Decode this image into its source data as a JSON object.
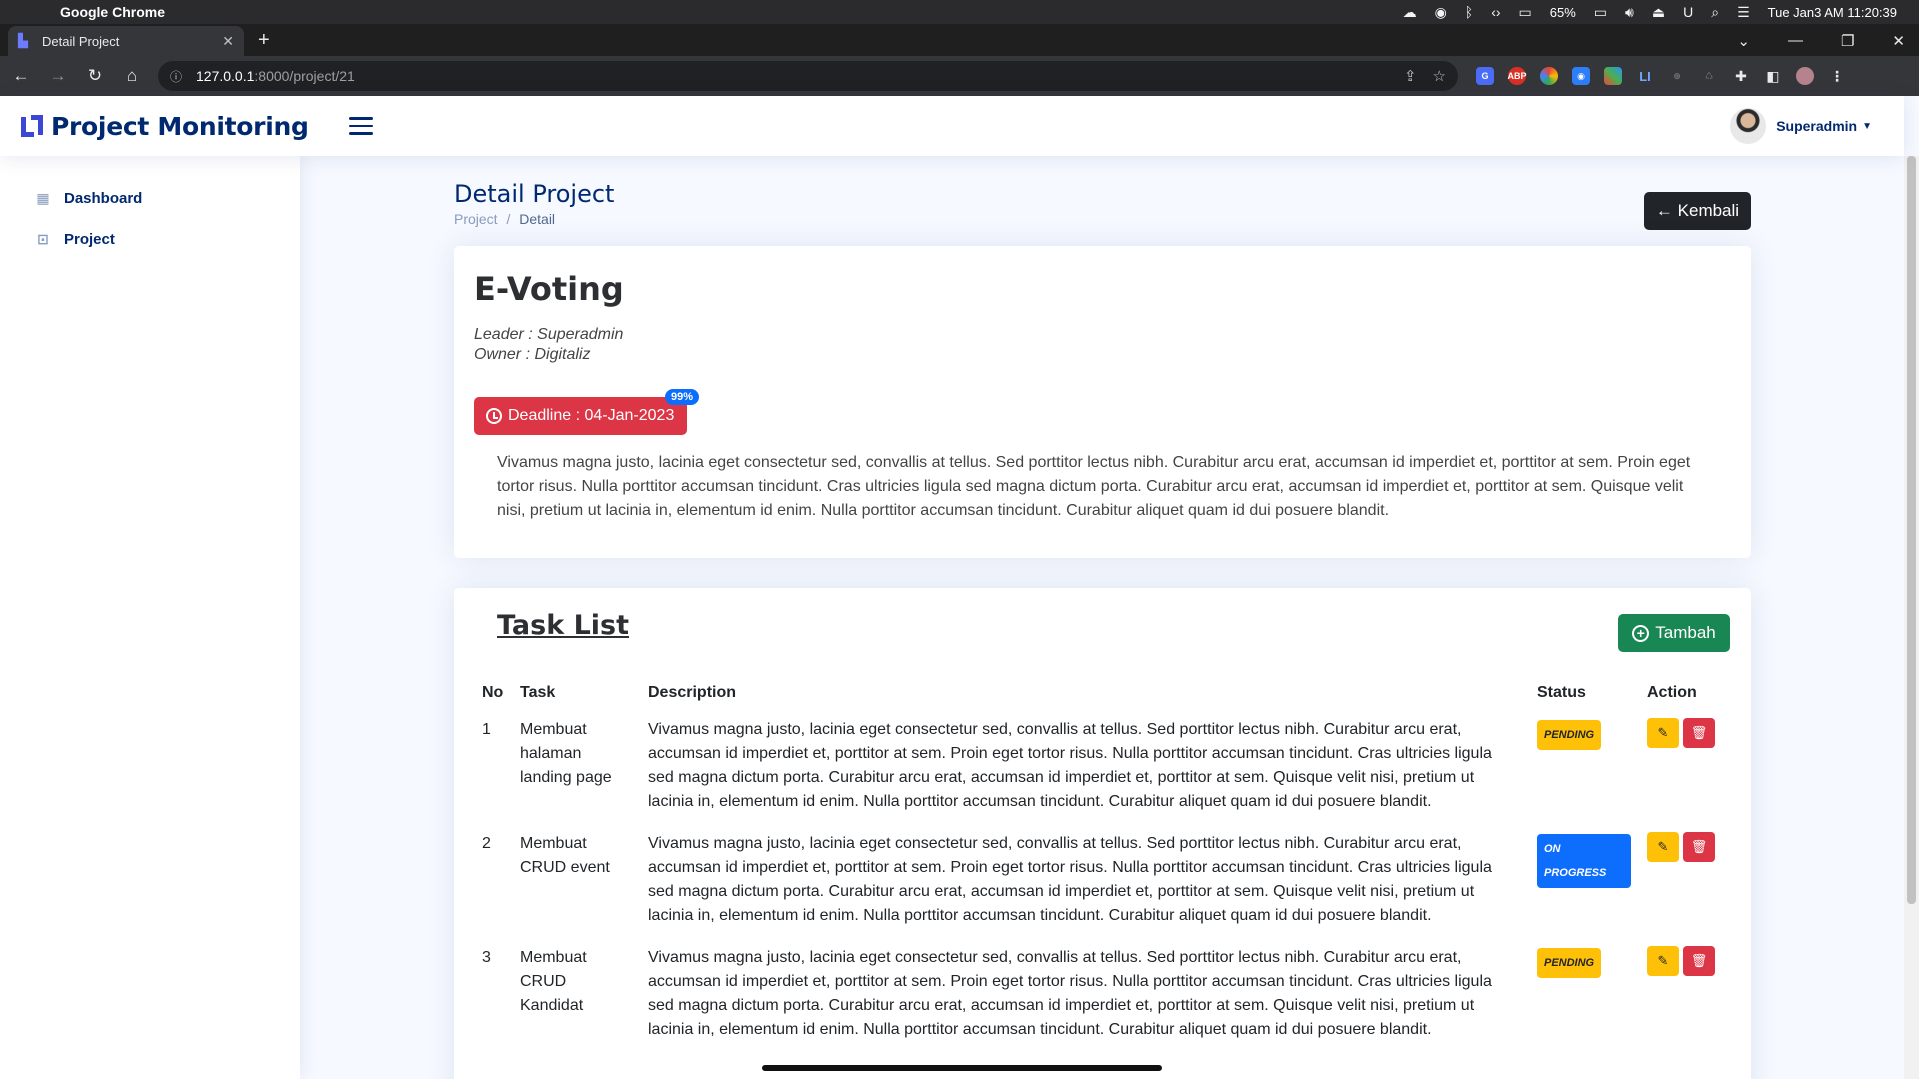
{
  "os_bar": {
    "app_name": "Google Chrome",
    "battery": "65%",
    "clock": "Tue Jan3 AM 11:20:39"
  },
  "browser": {
    "tab_title": "Detail Project",
    "url_host": "127.0.0.1",
    "url_path": ":8000/project/21"
  },
  "header": {
    "brand": "Project Monitoring",
    "user": "Superadmin"
  },
  "sidebar": {
    "items": [
      {
        "label": "Dashboard",
        "icon": "grid-icon"
      },
      {
        "label": "Project",
        "icon": "project-icon"
      }
    ]
  },
  "page": {
    "title": "Detail Project",
    "breadcrumb": [
      "Project",
      "/",
      "Detail"
    ],
    "back_label": "← Kembali"
  },
  "project": {
    "name": "E-Voting",
    "leader": "Leader : Superadmin",
    "owner": "Owner : Digitaliz",
    "deadline": "Deadline : 04-Jan-2023",
    "progress": "99%",
    "description": "Vivamus magna justo, lacinia eget consectetur sed, convallis at tellus. Sed porttitor lectus nibh. Curabitur arcu erat, accumsan id imperdiet et, porttitor at sem. Proin eget tortor risus. Nulla porttitor accumsan tincidunt. Cras ultricies ligula sed magna dictum porta. Curabitur arcu erat, accumsan id imperdiet et, porttitor at sem. Quisque velit nisi, pretium ut lacinia in, elementum id enim. Nulla porttitor accumsan tincidunt. Curabitur aliquet quam id dui posuere blandit."
  },
  "tasks": {
    "title": "Task List",
    "add_label": "Tambah",
    "columns": [
      "No",
      "Task",
      "Description",
      "Status",
      "Action"
    ],
    "rows": [
      {
        "no": "1",
        "task": "Membuat halaman landing page",
        "description": "Vivamus magna justo, lacinia eget consectetur sed, convallis at tellus. Sed porttitor lectus nibh. Curabitur arcu erat, accumsan id imperdiet et, porttitor at sem. Proin eget tortor risus. Nulla porttitor accumsan tincidunt. Cras ultricies ligula sed magna dictum porta. Curabitur arcu erat, accumsan id imperdiet et, porttitor at sem. Quisque velit nisi, pretium ut lacinia in, elementum id enim. Nulla porttitor accumsan tincidunt. Curabitur aliquet quam id dui posuere blandit.",
        "status": "PENDING"
      },
      {
        "no": "2",
        "task": "Membuat CRUD event",
        "description": "Vivamus magna justo, lacinia eget consectetur sed, convallis at tellus. Sed porttitor lectus nibh. Curabitur arcu erat, accumsan id imperdiet et, porttitor at sem. Proin eget tortor risus. Nulla porttitor accumsan tincidunt. Cras ultricies ligula sed magna dictum porta. Curabitur arcu erat, accumsan id imperdiet et, porttitor at sem. Quisque velit nisi, pretium ut lacinia in, elementum id enim. Nulla porttitor accumsan tincidunt. Curabitur aliquet quam id dui posuere blandit.",
        "status": "ON PROGRESS"
      },
      {
        "no": "3",
        "task": "Membuat CRUD Kandidat",
        "description": "Vivamus magna justo, lacinia eget consectetur sed, convallis at tellus. Sed porttitor lectus nibh. Curabitur arcu erat, accumsan id imperdiet et, porttitor at sem. Proin eget tortor risus. Nulla porttitor accumsan tincidunt. Cras ultricies ligula sed magna dictum porta. Curabitur arcu erat, accumsan id imperdiet et, porttitor at sem. Quisque velit nisi, pretium ut lacinia in, elementum id enim. Nulla porttitor accumsan tincidunt. Curabitur aliquet quam id dui posuere blandit.",
        "status": "PENDING"
      }
    ]
  },
  "colors": {
    "primary_text": "#012970",
    "danger": "#dc3545",
    "success": "#198754",
    "warning": "#ffc107",
    "info": "#0d6efd"
  }
}
